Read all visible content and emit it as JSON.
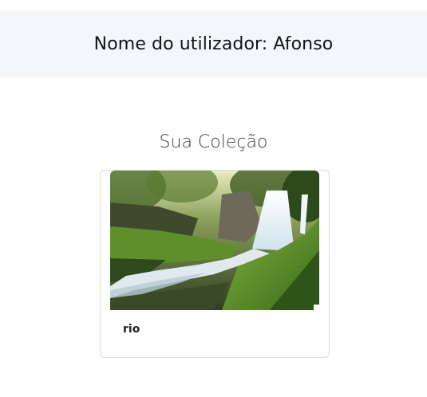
{
  "header": {
    "title": "Nome do utilizador: Afonso"
  },
  "collection": {
    "title": "Sua Coleção",
    "items": [
      {
        "label": "rio",
        "image_alt": "waterfall-photo"
      }
    ]
  }
}
